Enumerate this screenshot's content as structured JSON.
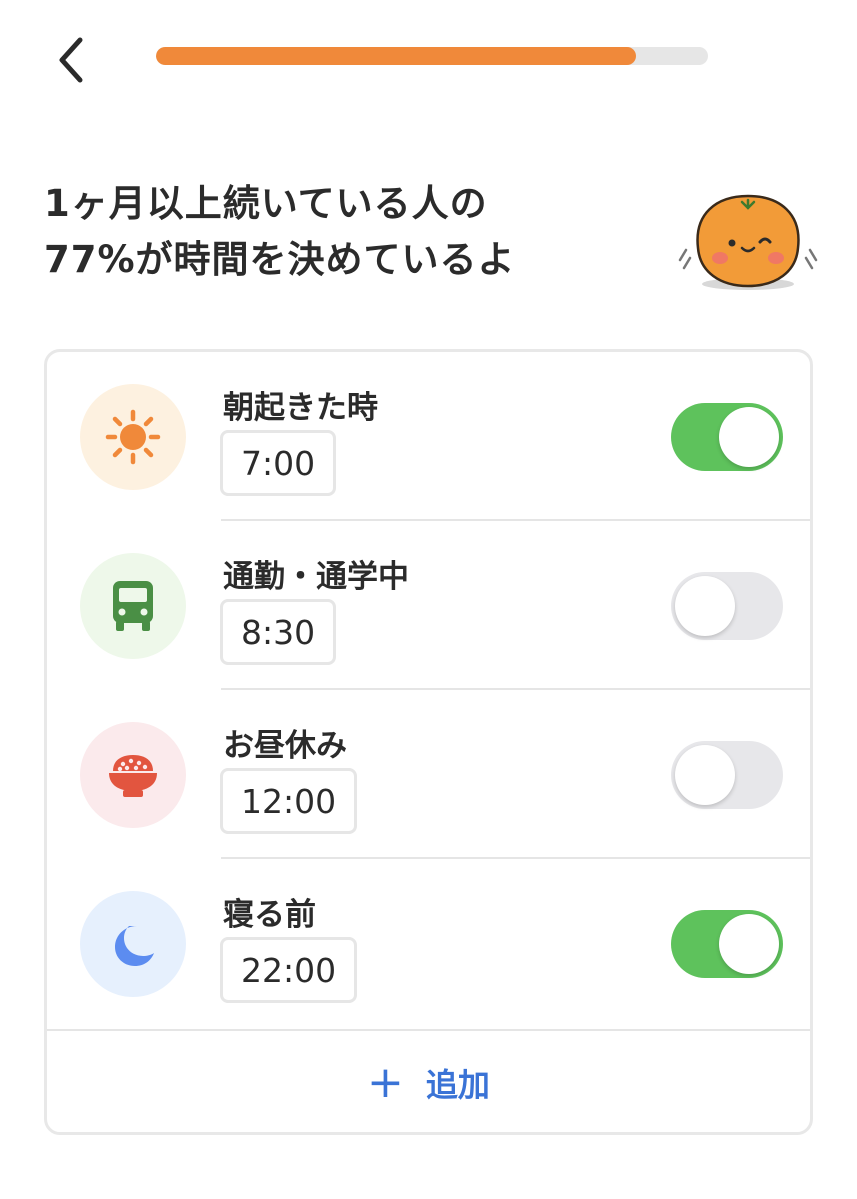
{
  "header": {
    "back_icon": "chevron-left-icon",
    "progress": 0.87,
    "progress_color": "#f0893a",
    "track_color": "#e6e6e6"
  },
  "heading": {
    "line1": "1ヶ月以上続いている人の",
    "line2": "77%が時間を決めているよ"
  },
  "mascot": {
    "icon": "orange-mascot-icon"
  },
  "items": [
    {
      "label": "朝起きた時",
      "time": "7:00",
      "icon": "sun-icon",
      "enabled": true,
      "icon_bg": "#fdf1e0",
      "icon_color": "#f0893a"
    },
    {
      "label": "通勤・通学中",
      "time": "8:30",
      "icon": "bus-icon",
      "enabled": false,
      "icon_bg": "#eef8ea",
      "icon_color": "#4a8f45"
    },
    {
      "label": "お昼休み",
      "time": "12:00",
      "icon": "rice-bowl-icon",
      "enabled": false,
      "icon_bg": "#fbeaec",
      "icon_color": "#e2553f"
    },
    {
      "label": "寝る前",
      "time": "22:00",
      "icon": "moon-icon",
      "enabled": true,
      "icon_bg": "#e6f0fd",
      "icon_color": "#5c8cf0"
    }
  ],
  "add": {
    "icon": "plus-icon",
    "label": "追加",
    "color": "#3a73d6"
  },
  "colors": {
    "toggle_on": "#5ec25c",
    "toggle_off": "#e7e7ea"
  }
}
